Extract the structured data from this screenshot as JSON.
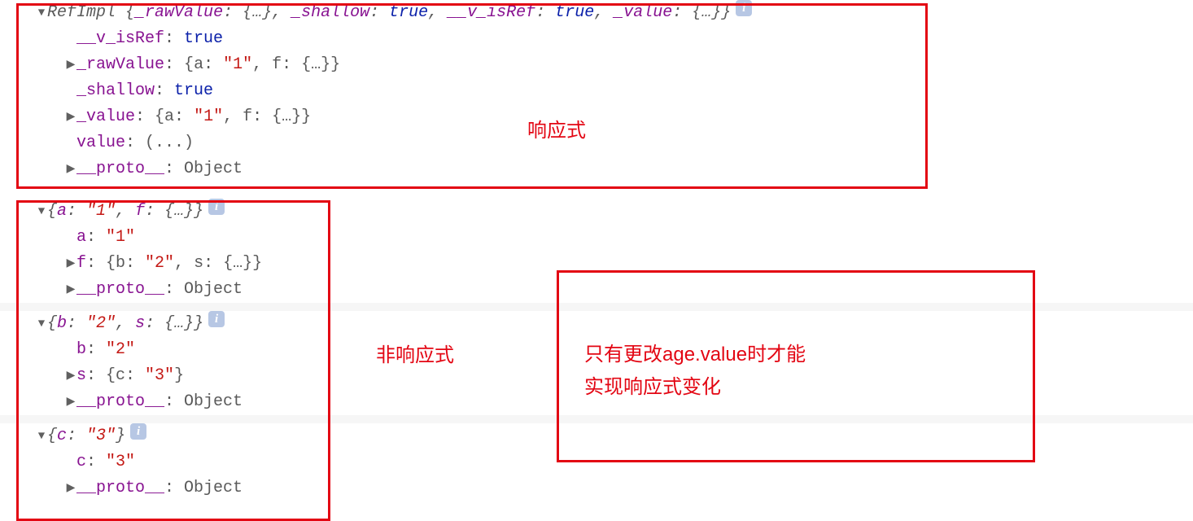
{
  "block1": {
    "header": {
      "class": "RefImpl",
      "preview": "{_rawValue: {…}, _shallow: true, __v_isRef: true, _value: {…}}"
    },
    "p1": {
      "k": "__v_isRef",
      "v": "true"
    },
    "p2": {
      "k": "_rawValue",
      "v": "{a: \"1\", f: {…}}"
    },
    "p3": {
      "k": "_shallow",
      "v": "true"
    },
    "p4": {
      "k": "_value",
      "v": "{a: \"1\", f: {…}}"
    },
    "p5": {
      "k": "value",
      "v": "(...)"
    },
    "p6": {
      "k": "__proto__",
      "v": "Object"
    }
  },
  "block2": {
    "header": "{a: \"1\", f: {…}}",
    "p1": {
      "k": "a",
      "v": "\"1\""
    },
    "p2": {
      "k": "f",
      "v": "{b: \"2\", s: {…}}"
    },
    "p3": {
      "k": "__proto__",
      "v": "Object"
    }
  },
  "block3": {
    "header": "{b: \"2\", s: {…}}",
    "p1": {
      "k": "b",
      "v": "\"2\""
    },
    "p2": {
      "k": "s",
      "v": "{c: \"3\"}"
    },
    "p3": {
      "k": "__proto__",
      "v": "Object"
    }
  },
  "block4": {
    "header": "{c: \"3\"}",
    "p1": {
      "k": "c",
      "v": "\"3\""
    },
    "p2": {
      "k": "__proto__",
      "v": "Object"
    }
  },
  "annot": {
    "label1": "响应式",
    "label2": "非响应式",
    "label3": "只有更改age.value时才能\n实现响应式变化"
  }
}
